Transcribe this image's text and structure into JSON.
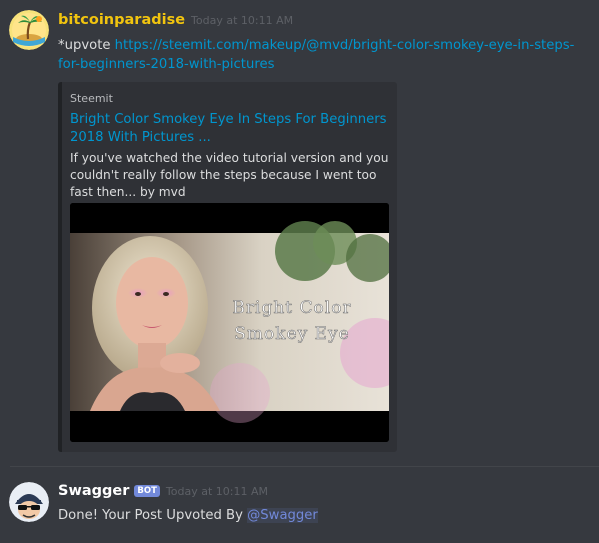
{
  "messages": [
    {
      "username": "bitcoinparadise",
      "timestamp": "Today at 10:11 AM",
      "text_prefix": "*upvote ",
      "link": "https://steemit.com/makeup/@mvd/bright-color-smokey-eye-in-steps-for-beginners-2018-with-pictures",
      "avatar_icon": "palm-island-icon",
      "username_color": "#f1c40f",
      "embed": {
        "provider": "Steemit",
        "title": "Bright Color Smokey Eye In Steps For Beginners 2018 With Pictures ...",
        "description": "If you've watched the video tutorial version and you couldn't really follow the steps because I went too fast then... by mvd",
        "image_caption_line1": "Bright Color",
        "image_caption_line2": "Smokey Eye"
      }
    },
    {
      "username": "Swagger",
      "bot_tag": "BOT",
      "timestamp": "Today at 10:11 AM",
      "text_prefix": "Done! Your Post Upvoted By ",
      "mention": "@Swagger",
      "avatar_icon": "sunglasses-bot-icon",
      "username_color": "#ffffff"
    }
  ],
  "colors": {
    "background": "#36393f",
    "link": "#0096cf",
    "bot_tag": "#7289da",
    "embed_bg": "#2f3136"
  }
}
